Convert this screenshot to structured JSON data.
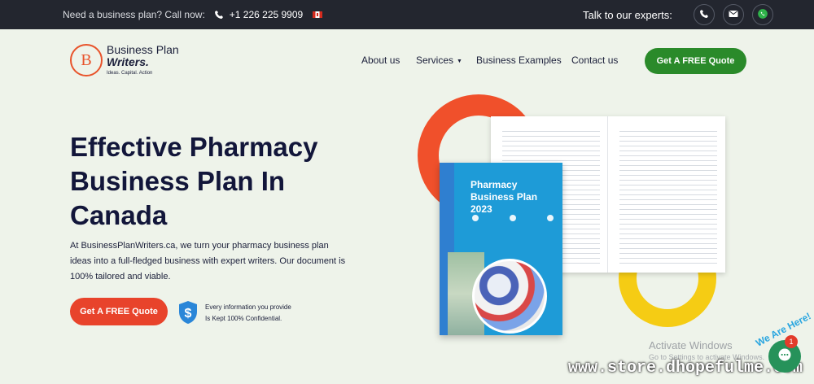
{
  "topbar": {
    "lead": "Need a business plan? Call now:",
    "phone": "+1 226 225 9909",
    "talk_label": "Talk to our experts:",
    "icons": [
      "phone-icon",
      "canada-flag-icon",
      "phone-icon",
      "mail-icon",
      "whatsapp-icon"
    ]
  },
  "logo": {
    "mark": "B",
    "line1": "Business Plan",
    "line2": "Writers.",
    "tagline": "Ideas. Capital. Action"
  },
  "nav": {
    "about": "About us",
    "services": "Services",
    "examples": "Business Examples",
    "contact": "Contact us",
    "cta": "Get A FREE Quote"
  },
  "hero": {
    "title_lines": [
      "Effective Pharmacy",
      "Business Plan In",
      "Canada"
    ],
    "description": "At BusinessPlanWriters.ca, we turn your pharmacy business plan ideas into a full-fledged business with expert writers. Our document is 100% tailored and viable.",
    "cta": "Get A FREE Quote",
    "confidential_line1": "Every information you provide",
    "confidential_line2": "Is Kept 100% Confidential."
  },
  "book": {
    "title_line1": "Pharmacy",
    "title_line2": "Business Plan",
    "title_line3": "2023"
  },
  "overlay": {
    "activate": "Activate Windows",
    "activate_sub": "Go to Settings to activate Windows.",
    "site": "www.store.dhopefulme.com",
    "chat_badge": "1",
    "we_are_here": "We Are Here!"
  },
  "colors": {
    "accent_green": "#2a8a2a",
    "accent_orange": "#e8432b",
    "ring_red": "#f0502b",
    "ring_yellow": "#f5cc14",
    "topbar": "#23262f"
  }
}
